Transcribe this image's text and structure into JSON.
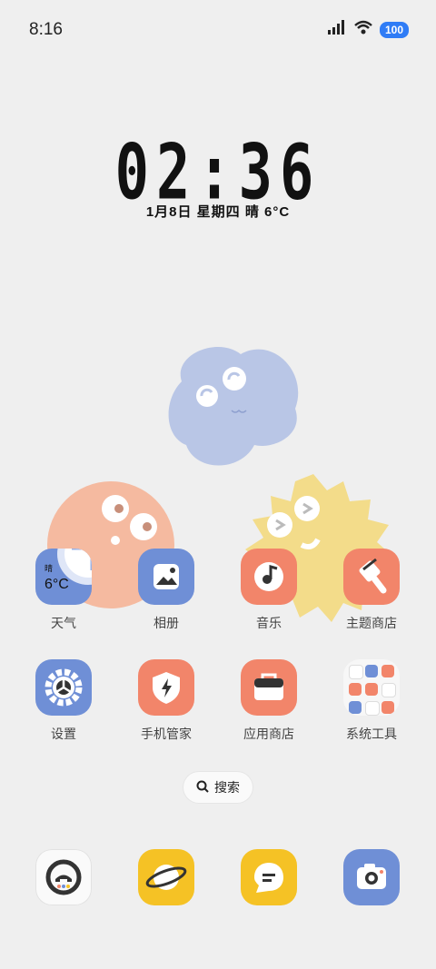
{
  "status_bar": {
    "time": "8:16",
    "battery": "100",
    "signal_icon": "signal-icon",
    "wifi_icon": "wifi-icon"
  },
  "clock": {
    "time": "02:36",
    "date_line": "1月8日  星期四  晴  6°C"
  },
  "apps_row1": [
    {
      "id": "weather",
      "label": "天气",
      "weather_text": "晴",
      "weather_temp": "6°C"
    },
    {
      "id": "photos",
      "label": "相册"
    },
    {
      "id": "music",
      "label": "音乐"
    },
    {
      "id": "theme-store",
      "label": "主题商店"
    }
  ],
  "apps_row2": [
    {
      "id": "settings",
      "label": "设置"
    },
    {
      "id": "phone-manager",
      "label": "手机管家"
    },
    {
      "id": "app-store",
      "label": "应用商店"
    },
    {
      "id": "system-tools",
      "label": "系统工具"
    }
  ],
  "search": {
    "label": "搜索"
  },
  "dock": [
    {
      "id": "phone",
      "icon": "phone-icon"
    },
    {
      "id": "browser",
      "icon": "planet-icon"
    },
    {
      "id": "messages",
      "icon": "message-icon"
    },
    {
      "id": "camera",
      "icon": "camera-icon"
    }
  ],
  "colors": {
    "blue": "#6f8fd6",
    "coral": "#f2856a",
    "yellow": "#f5c225",
    "background": "#efefef",
    "battery": "#2f7cf6"
  }
}
